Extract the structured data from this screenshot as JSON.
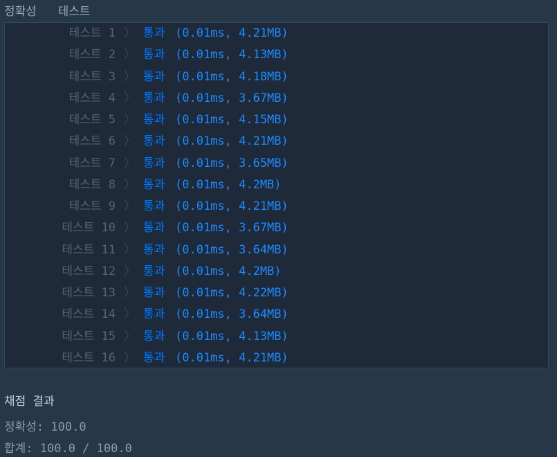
{
  "header": {
    "tab_accuracy": "정확성",
    "tab_test": "테스트"
  },
  "tests": [
    {
      "label": "테스트 1",
      "status": "통과",
      "detail": "(0.01ms, 4.21MB)"
    },
    {
      "label": "테스트 2",
      "status": "통과",
      "detail": "(0.01ms, 4.13MB)"
    },
    {
      "label": "테스트 3",
      "status": "통과",
      "detail": "(0.01ms, 4.18MB)"
    },
    {
      "label": "테스트 4",
      "status": "통과",
      "detail": "(0.01ms, 3.67MB)"
    },
    {
      "label": "테스트 5",
      "status": "통과",
      "detail": "(0.01ms, 4.15MB)"
    },
    {
      "label": "테스트 6",
      "status": "통과",
      "detail": "(0.01ms, 4.21MB)"
    },
    {
      "label": "테스트 7",
      "status": "통과",
      "detail": "(0.01ms, 3.65MB)"
    },
    {
      "label": "테스트 8",
      "status": "통과",
      "detail": "(0.01ms, 4.2MB)"
    },
    {
      "label": "테스트 9",
      "status": "통과",
      "detail": "(0.01ms, 4.21MB)"
    },
    {
      "label": "테스트 10",
      "status": "통과",
      "detail": "(0.01ms, 3.67MB)"
    },
    {
      "label": "테스트 11",
      "status": "통과",
      "detail": "(0.01ms, 3.64MB)"
    },
    {
      "label": "테스트 12",
      "status": "통과",
      "detail": "(0.01ms, 4.2MB)"
    },
    {
      "label": "테스트 13",
      "status": "통과",
      "detail": "(0.01ms, 4.22MB)"
    },
    {
      "label": "테스트 14",
      "status": "통과",
      "detail": "(0.01ms, 3.64MB)"
    },
    {
      "label": "테스트 15",
      "status": "통과",
      "detail": "(0.01ms, 4.13MB)"
    },
    {
      "label": "테스트 16",
      "status": "통과",
      "detail": "(0.01ms, 4.21MB)"
    }
  ],
  "summary": {
    "title": "채점 결과",
    "accuracy": "정확성: 100.0",
    "total": "합계: 100.0 / 100.0"
  },
  "icons": {
    "chevron": "〉"
  },
  "colors": {
    "background": "#263747",
    "panel": "#1e2a3a",
    "pass": "#0078ff",
    "muted_label": "#546474"
  }
}
